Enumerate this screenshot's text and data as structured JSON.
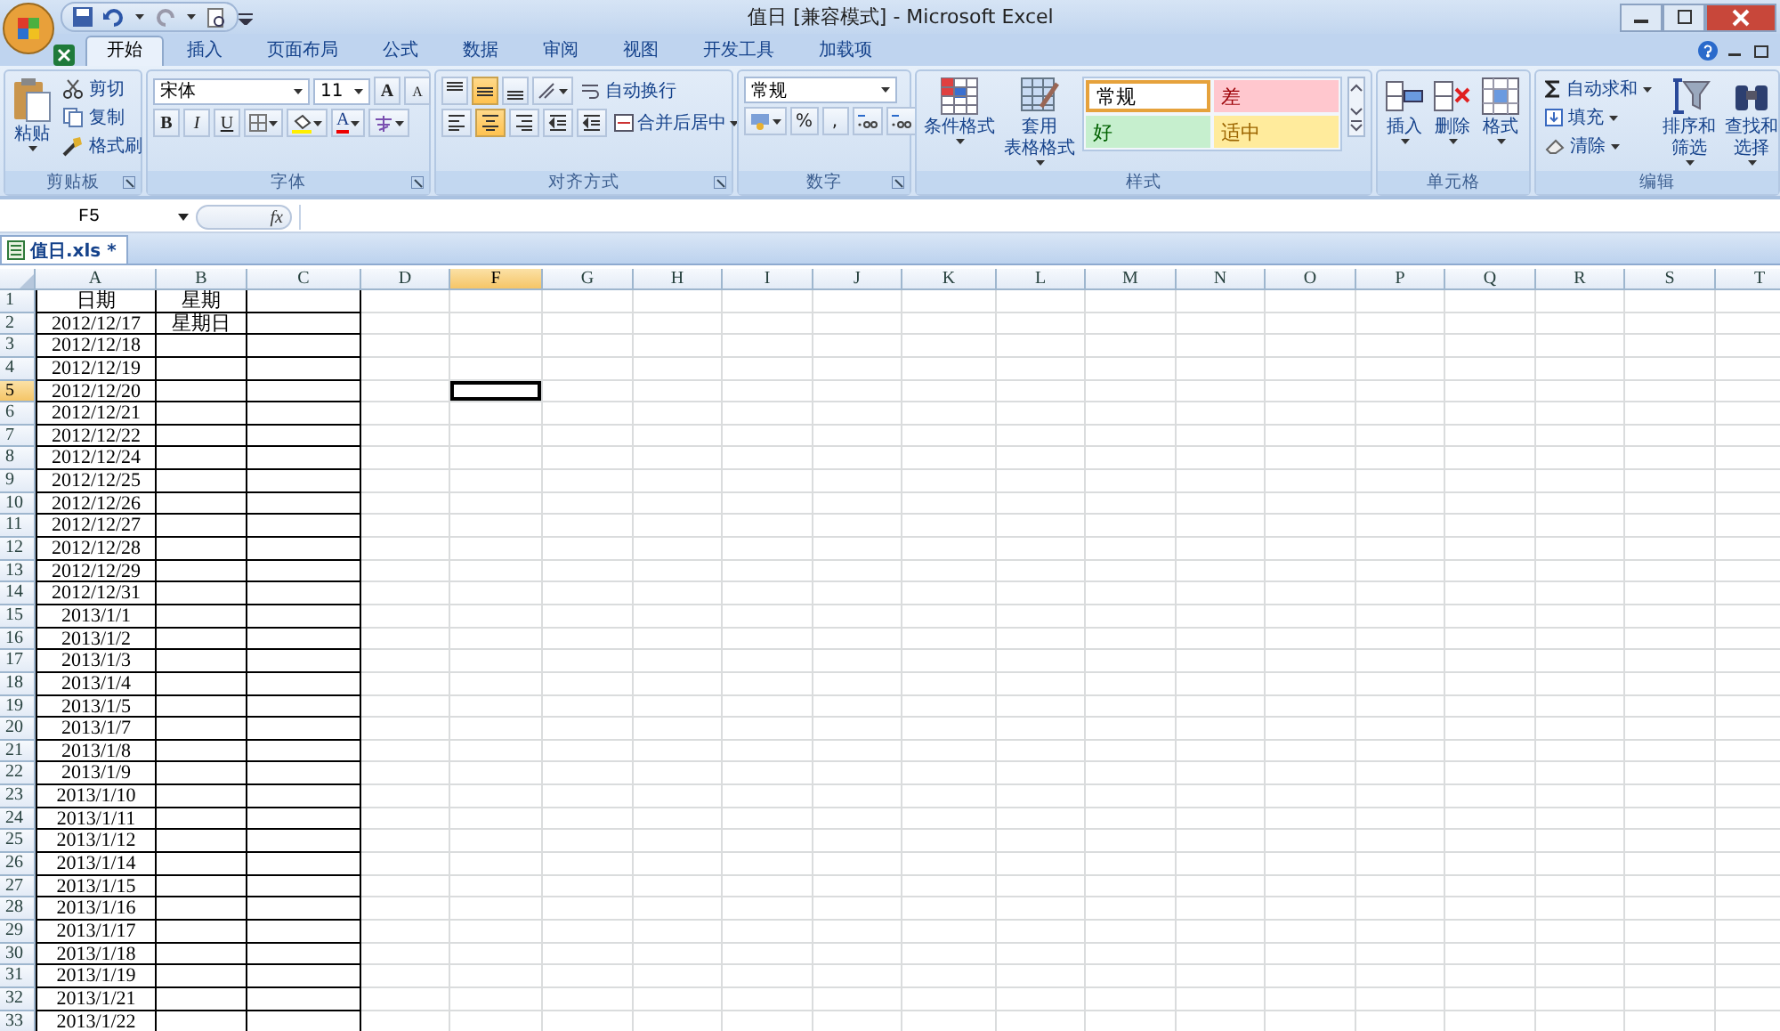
{
  "window": {
    "title": "值日  [兼容模式] - Microsoft Excel"
  },
  "tabs": [
    {
      "label": "开始",
      "selected": true
    },
    {
      "label": "插入",
      "selected": false
    },
    {
      "label": "页面布局",
      "selected": false
    },
    {
      "label": "公式",
      "selected": false
    },
    {
      "label": "数据",
      "selected": false
    },
    {
      "label": "审阅",
      "selected": false
    },
    {
      "label": "视图",
      "selected": false
    },
    {
      "label": "开发工具",
      "selected": false
    },
    {
      "label": "加载项",
      "selected": false
    }
  ],
  "ribbon": [
    {
      "kind": "clipboard",
      "title": "剪贴板",
      "launcher": true,
      "paste": "粘贴",
      "items": [
        "剪切",
        "复制",
        "格式刷"
      ]
    },
    {
      "kind": "font",
      "title": "字体",
      "launcher": true,
      "font_name": "宋体",
      "font_size": "11",
      "grow": "A",
      "shrink": "A",
      "styles": [
        "B",
        "I",
        "U"
      ],
      "font_color": "A"
    },
    {
      "kind": "alignment",
      "title": "对齐方式",
      "launcher": true,
      "vertical": [
        {
          "selected": false
        },
        {
          "selected": true
        },
        {
          "selected": false
        }
      ],
      "horizontal": [
        {
          "selected": false
        },
        {
          "selected": true
        },
        {
          "selected": false
        }
      ],
      "wrap": "自动换行",
      "merge": "合并后居中"
    },
    {
      "kind": "number",
      "title": "数字",
      "launcher": true,
      "format": "常规",
      "percent": "%",
      "comma": ","
    },
    {
      "kind": "styles",
      "title": "样式",
      "launcher": false,
      "conditional": "条件格式",
      "table": [
        "套用",
        "表格格式"
      ],
      "cell_styles": [
        {
          "label": "常规",
          "kind": "normal"
        },
        {
          "label": "差",
          "kind": "bad"
        },
        {
          "label": "好",
          "kind": "good"
        },
        {
          "label": "适中",
          "kind": "neutral"
        }
      ]
    },
    {
      "kind": "cells",
      "title": "单元格",
      "launcher": false,
      "buttons": [
        "插入",
        "删除",
        "格式"
      ]
    },
    {
      "kind": "editing",
      "title": "编辑",
      "launcher": false,
      "items": [
        "自动求和",
        "填充",
        "清除"
      ],
      "sort": [
        "排序和",
        "筛选"
      ],
      "find": [
        "查找和",
        "选择"
      ]
    }
  ],
  "formula_bar": {
    "name_box": "F5",
    "fx": "fx"
  },
  "workbook_tab": "值日.xls *",
  "sheet": {
    "columns": [
      {
        "label": "A",
        "selected": false
      },
      {
        "label": "B",
        "selected": false
      },
      {
        "label": "C",
        "selected": false
      },
      {
        "label": "D",
        "selected": false
      },
      {
        "label": "F",
        "selected": true
      },
      {
        "label": "G",
        "selected": false
      },
      {
        "label": "H",
        "selected": false
      },
      {
        "label": "I",
        "selected": false
      },
      {
        "label": "J",
        "selected": false
      },
      {
        "label": "K",
        "selected": false
      },
      {
        "label": "L",
        "selected": false
      },
      {
        "label": "M",
        "selected": false
      },
      {
        "label": "N",
        "selected": false
      },
      {
        "label": "O",
        "selected": false
      },
      {
        "label": "P",
        "selected": false
      },
      {
        "label": "Q",
        "selected": false
      },
      {
        "label": "R",
        "selected": false
      },
      {
        "label": "S",
        "selected": false
      },
      {
        "label": "T",
        "selected": false
      }
    ],
    "rows": [
      {
        "header": "1",
        "selected": false,
        "cells": [
          "日期",
          "星期"
        ]
      },
      {
        "header": "2",
        "selected": false,
        "cells": [
          "2012/12/17",
          "星期日"
        ]
      },
      {
        "header": "3",
        "selected": false,
        "cells": [
          "2012/12/18"
        ]
      },
      {
        "header": "4",
        "selected": false,
        "cells": [
          "2012/12/19"
        ]
      },
      {
        "header": "5",
        "selected": true,
        "cells": [
          "2012/12/20"
        ]
      },
      {
        "header": "6",
        "selected": false,
        "cells": [
          "2012/12/21"
        ]
      },
      {
        "header": "7",
        "selected": false,
        "cells": [
          "2012/12/22"
        ]
      },
      {
        "header": "8",
        "selected": false,
        "cells": [
          "2012/12/24"
        ]
      },
      {
        "header": "9",
        "selected": false,
        "cells": [
          "2012/12/25"
        ]
      },
      {
        "header": "10",
        "selected": false,
        "cells": [
          "2012/12/26"
        ]
      },
      {
        "header": "11",
        "selected": false,
        "cells": [
          "2012/12/27"
        ]
      },
      {
        "header": "12",
        "selected": false,
        "cells": [
          "2012/12/28"
        ]
      },
      {
        "header": "13",
        "selected": false,
        "cells": [
          "2012/12/29"
        ]
      },
      {
        "header": "14",
        "selected": false,
        "cells": [
          "2012/12/31"
        ]
      },
      {
        "header": "15",
        "selected": false,
        "cells": [
          "2013/1/1"
        ]
      },
      {
        "header": "16",
        "selected": false,
        "cells": [
          "2013/1/2"
        ]
      },
      {
        "header": "17",
        "selected": false,
        "cells": [
          "2013/1/3"
        ]
      },
      {
        "header": "18",
        "selected": false,
        "cells": [
          "2013/1/4"
        ]
      },
      {
        "header": "19",
        "selected": false,
        "cells": [
          "2013/1/5"
        ]
      },
      {
        "header": "20",
        "selected": false,
        "cells": [
          "2013/1/7"
        ]
      },
      {
        "header": "21",
        "selected": false,
        "cells": [
          "2013/1/8"
        ]
      },
      {
        "header": "22",
        "selected": false,
        "cells": [
          "2013/1/9"
        ]
      },
      {
        "header": "23",
        "selected": false,
        "cells": [
          "2013/1/10"
        ]
      },
      {
        "header": "24",
        "selected": false,
        "cells": [
          "2013/1/11"
        ]
      },
      {
        "header": "25",
        "selected": false,
        "cells": [
          "2013/1/12"
        ]
      },
      {
        "header": "26",
        "selected": false,
        "cells": [
          "2013/1/14"
        ]
      },
      {
        "header": "27",
        "selected": false,
        "cells": [
          "2013/1/15"
        ]
      },
      {
        "header": "28",
        "selected": false,
        "cells": [
          "2013/1/16"
        ]
      },
      {
        "header": "29",
        "selected": false,
        "cells": [
          "2013/1/17"
        ]
      },
      {
        "header": "30",
        "selected": false,
        "cells": [
          "2013/1/18"
        ]
      },
      {
        "header": "31",
        "selected": false,
        "cells": [
          "2013/1/19"
        ]
      },
      {
        "header": "32",
        "selected": false,
        "cells": [
          "2013/1/21"
        ]
      },
      {
        "header": "33",
        "selected": false,
        "cells": [
          "2013/1/22"
        ]
      }
    ]
  }
}
